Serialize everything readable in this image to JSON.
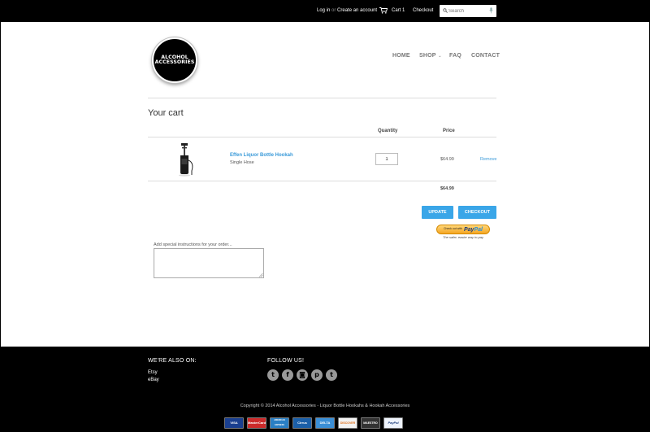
{
  "topbar": {
    "login": "Log in",
    "or": "or",
    "create_account": "Create an account",
    "cart": "Cart",
    "cart_count": "1",
    "checkout": "Checkout",
    "search_placeholder": "Search"
  },
  "logo": {
    "line1": "ALCOHOL",
    "line2": "ACCESSORIES"
  },
  "nav": {
    "home": "HOME",
    "shop": "SHOP",
    "faq": "FAQ",
    "contact": "CONTACT"
  },
  "cart": {
    "title": "Your cart",
    "headers": {
      "quantity": "Quantity",
      "price": "Price"
    },
    "items": [
      {
        "name": "Effen Liquor Bottle Hookah",
        "variant": "Single Hose",
        "quantity": "1",
        "price": "$64.99",
        "remove": "Remove"
      }
    ],
    "subtotal": "$64.99",
    "update_label": "UPDATE",
    "checkout_label": "CHECKOUT",
    "paypal": {
      "small": "Check out with",
      "brand_a": "Pay",
      "brand_b": "Pal",
      "tagline": "The safer, easier way to pay"
    },
    "instructions_label": "Add special instructions for your order..."
  },
  "footer": {
    "also_on_heading": "WE'RE ALSO ON:",
    "also_on_links": [
      "Etsy",
      "eBay"
    ],
    "follow_heading": "FOLLOW US!",
    "social_icons": [
      "twitter-icon",
      "facebook-icon",
      "instagram-icon",
      "pinterest-icon",
      "tumblr-icon"
    ],
    "copyright": "Copyright © 2014 Alcohol Accessories - Liquor Bottle Hookahs & Hookah Accessories",
    "payment_cards": [
      "VISA",
      "MasterCard",
      "AMERICAN EXPRESS",
      "Cirrus",
      "DELTA",
      "DISCOVER",
      "MAESTRO",
      "PayPal"
    ]
  },
  "colors": {
    "accent": "#3aa6e8",
    "link": "#3a9ad9",
    "background": "#000000"
  }
}
